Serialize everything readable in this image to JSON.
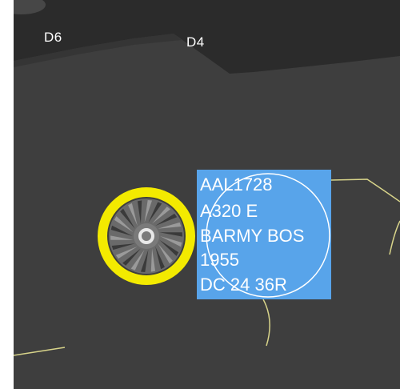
{
  "map": {
    "gates": [
      {
        "label": "D6"
      },
      {
        "label": "D4"
      }
    ]
  },
  "selected_aircraft": {
    "icon": "aircraft-engine-icon",
    "highlight_color": "#f3ea00"
  },
  "data_block": {
    "background_color": "#58a4ea",
    "lines": [
      "AAL1728",
      "A320 E",
      "BARMY BOS",
      "1955",
      "DC 24 36R"
    ]
  },
  "colors": {
    "ground": "#3e3e3e",
    "building": "#2b2b2b",
    "taxi_line": "#d8d48a"
  }
}
